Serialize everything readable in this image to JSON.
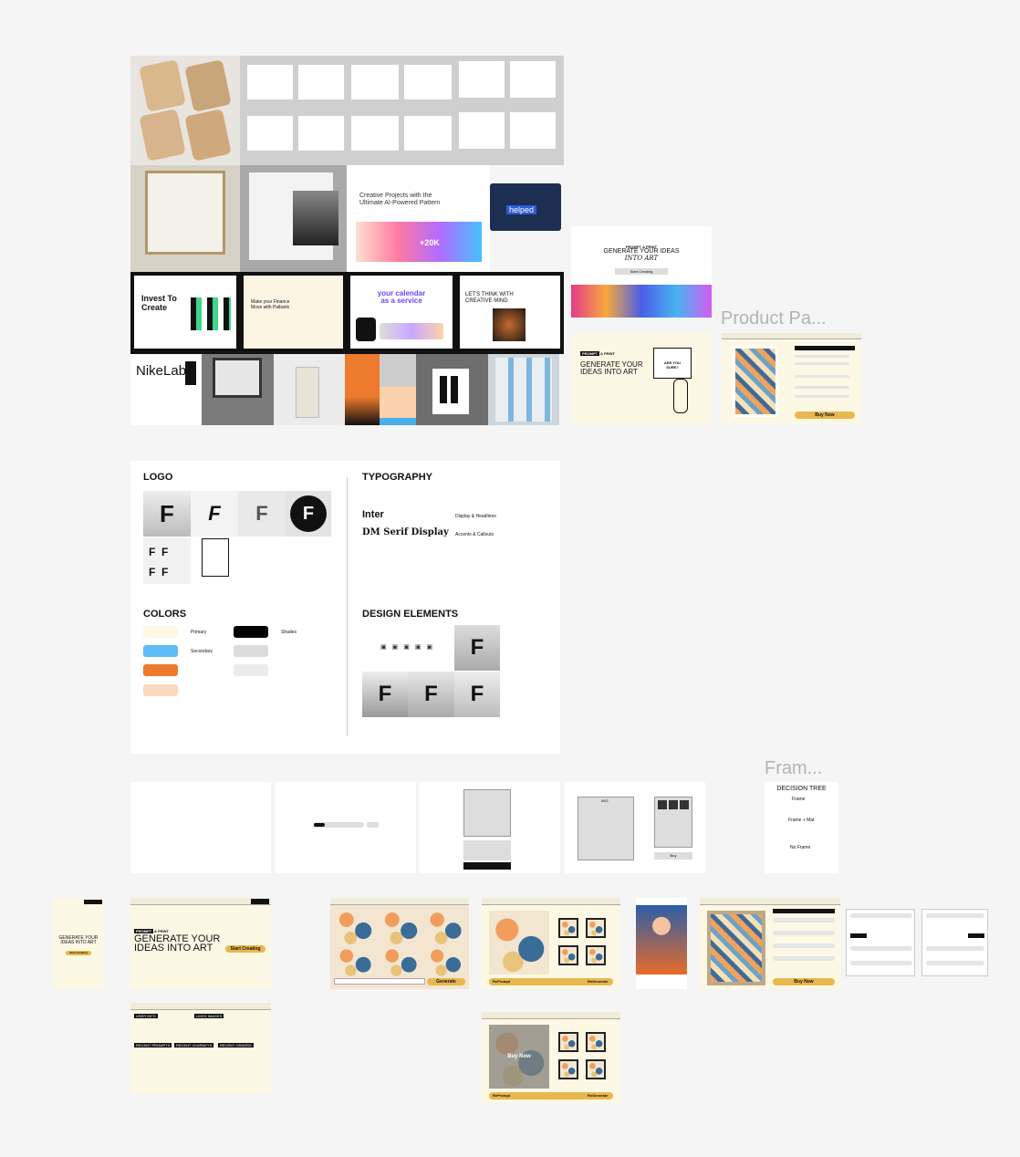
{
  "frames": {
    "product_page_label": "Product Pa...",
    "frame_label": "Fram..."
  },
  "moodboard": {
    "creative_title": "Creative Projects with the Ultimate AI-Powered Pattern",
    "creative_stat": "+20K",
    "helped_label": "helped",
    "invest_title": "Invest To Create",
    "finance_title": "Make your Finance Move with Paibank",
    "calendar_title": "your calendar as a service",
    "think_title": "LET'S THINK WITH CREATIVE MIND",
    "nikelab": "NikeLab"
  },
  "hero_mock_1": {
    "eyebrow": "PROMPT & PRINT",
    "title_line1": "GENERATE YOUR IDEAS",
    "title_line2": "INTO ART",
    "button": "Start Creating"
  },
  "hero_mock_2": {
    "eyebrow_badge": "PROMPT",
    "eyebrow_rest": "& PRINT",
    "title_line1": "GENERATE YOUR",
    "title_line2": "IDEAS INTO ART",
    "speech": "ARE YOU SURE?"
  },
  "product_mock": {
    "buy_button": "Buy Now"
  },
  "brand": {
    "logo_heading": "LOGO",
    "typography_heading": "TYPOGRAPHY",
    "font1_name": "Inter",
    "font1_role": "Display & Headlines",
    "font2_name": "DM Serif Display",
    "font2_role": "Accents & Callouts",
    "colors_heading": "COLORS",
    "primary_label": "Primary",
    "secondary_label": "Secondary",
    "shades_label": "Shades",
    "design_elements_heading": "DESIGN ELEMENTS",
    "colors": {
      "primary": "#fdf8e4",
      "secondary": "#5bbcf5",
      "accent_orange": "#ee7a2e",
      "accent_peach": "#fbd9c0",
      "black": "#000000",
      "gray": "#dcdcdc",
      "light_gray": "#ececec",
      "button_yellow": "#e8b74e"
    }
  },
  "wireframes": {
    "img_label": "IMG",
    "buy_label": "Buy",
    "decision_title": "DECISION TREE",
    "opt_frame": "Frame",
    "opt_frame_mat": "Frame + Mat",
    "opt_no_frame": "No Frame"
  },
  "flow": {
    "start_button": "Start Creating",
    "generate_button": "Generate",
    "reprompt": "RePrompt",
    "regenerate": "ReGenerate",
    "buy_now": "Buy Now",
    "user_info": "USER INFO",
    "liked_images": "LIKED IMAGES",
    "recent_prompts": "RECENT PROMPTS",
    "recent_journeys": "RECENT JOURNEYS",
    "recent_orders": "RECENT ORDERS",
    "hero_title_1": "GENERATE YOUR",
    "hero_title_2": "IDEAS INTO ART",
    "hero_eyebrow_badge": "PROMPT",
    "hero_eyebrow_rest": "& PRINT"
  }
}
